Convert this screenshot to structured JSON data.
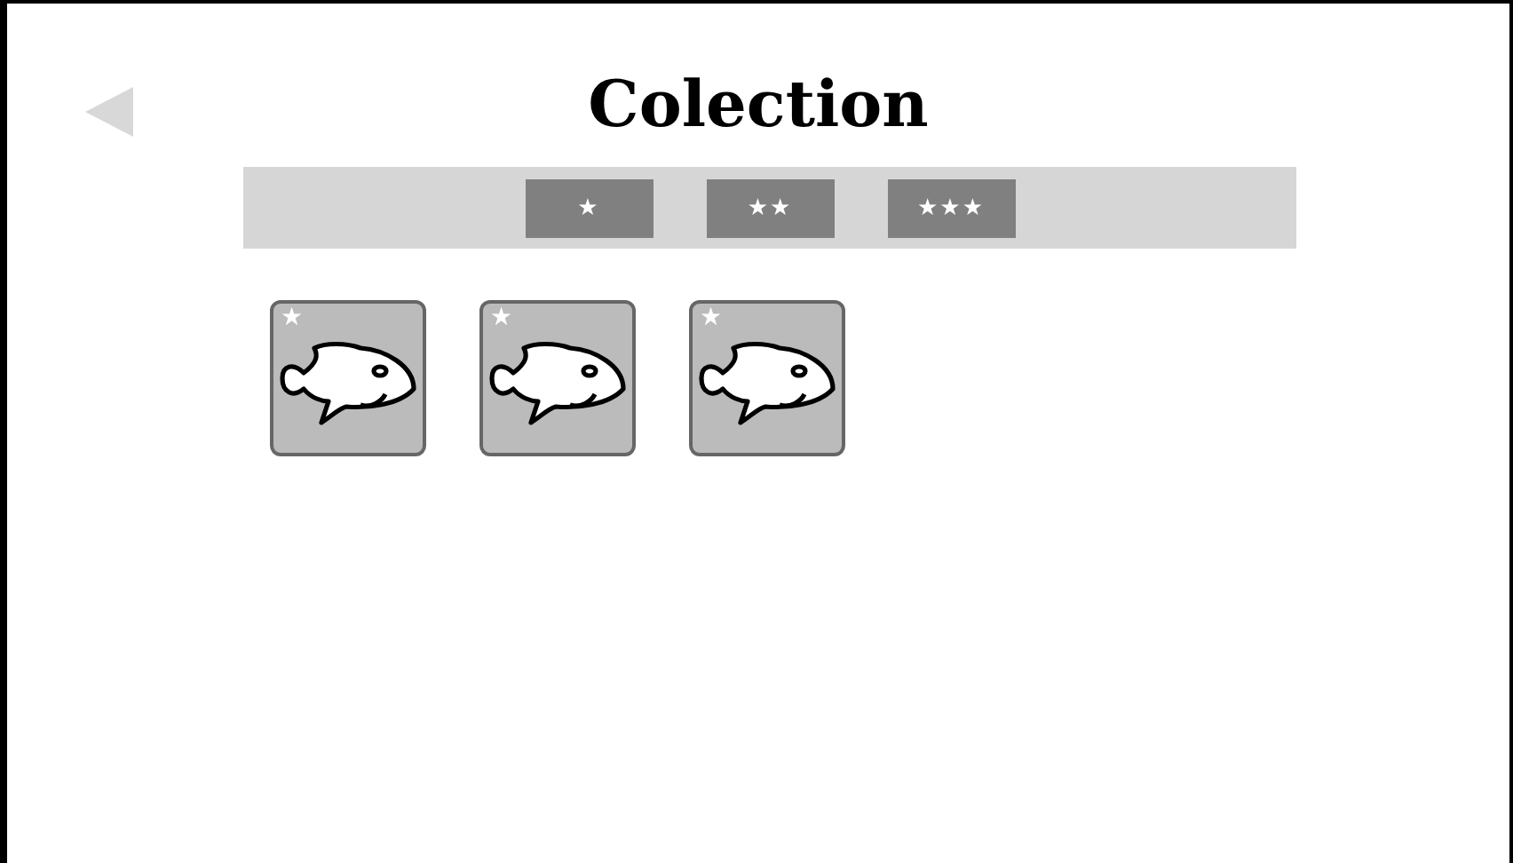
{
  "title": "Colection",
  "filter_tabs": [
    {
      "label": "★",
      "selected": false
    },
    {
      "label": "★★",
      "selected": false
    },
    {
      "label": "★★★",
      "selected": false
    }
  ],
  "items": [
    {
      "badge": "★"
    },
    {
      "badge": "★"
    },
    {
      "badge": "★"
    }
  ]
}
